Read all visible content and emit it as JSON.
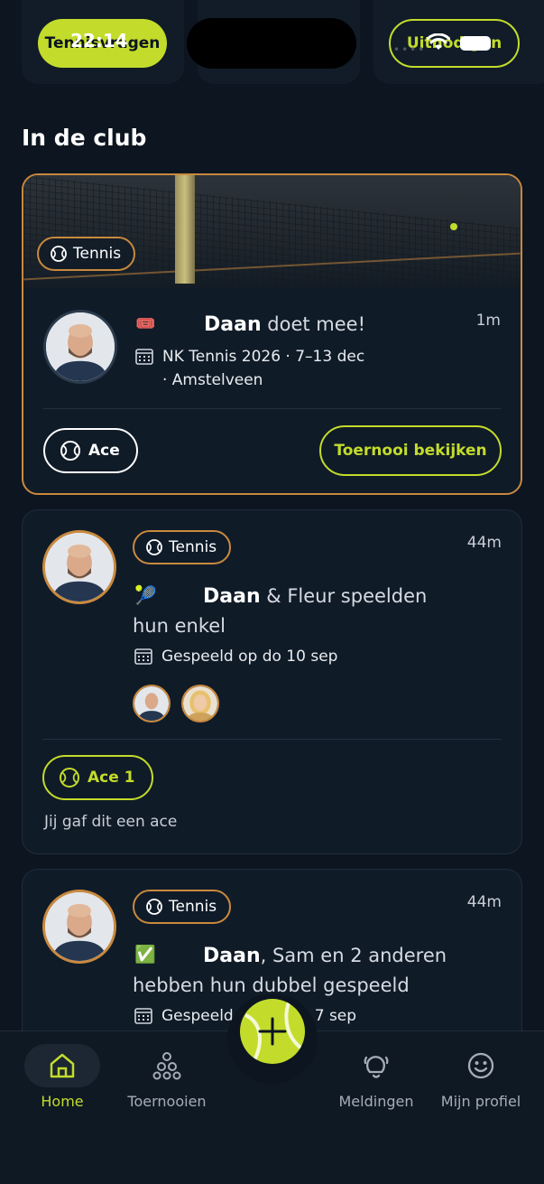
{
  "status_bar": {
    "time": "22:14"
  },
  "top_filters": {
    "left_label": "Tennisvragen",
    "right_label": "Uitnodigen"
  },
  "section": {
    "title": "In de club"
  },
  "cards": [
    {
      "tag": "Tennis",
      "time": "1m",
      "emoji": "🎟️",
      "actor": "Daan",
      "text": " doet mee!",
      "meta_line1": "NK Tennis 2026 · 7–13 dec",
      "meta_line2": "· Amstelveen",
      "ace_label": "Ace",
      "action_label": "Toernooi bekijken"
    },
    {
      "tag": "Tennis",
      "time": "44m",
      "emoji": "🎾",
      "actor": "Daan",
      "text": " & Fleur speelden",
      "text_line2": "hun enkel",
      "meta": "Gespeeld op do 10 sep",
      "ace_label": "Ace 1",
      "note": "Jij gaf dit een ace"
    },
    {
      "tag": "Tennis",
      "time": "44m",
      "emoji": "✅",
      "actor": "Daan",
      "text": ", Sam en 2 anderen",
      "text_line2": "hebben hun dubbel gespeeld",
      "meta_start": "Gespeeld",
      "meta_end": "7 sep"
    }
  ],
  "bottom_nav": {
    "items": [
      {
        "label": "Home",
        "icon": "home-icon",
        "active": true
      },
      {
        "label": "Toernooien",
        "icon": "tournament-icon",
        "active": false
      },
      {
        "label": "Meldingen",
        "icon": "bell-icon",
        "active": false
      },
      {
        "label": "Mijn profiel",
        "icon": "smiley-icon",
        "active": false
      }
    ]
  },
  "colors": {
    "accent": "#c3dc2b",
    "highlight_border": "#c8893e",
    "background": "#0c1520"
  }
}
